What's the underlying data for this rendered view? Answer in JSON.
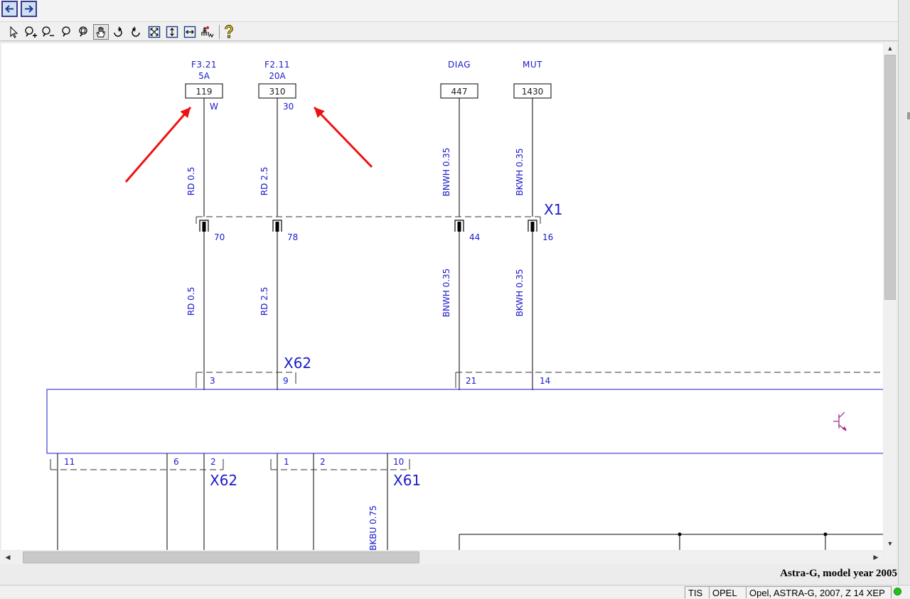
{
  "toolbar": {
    "tools": [
      "select-tool",
      "zoom-in-tool",
      "zoom-out-tool",
      "zoom-tool",
      "zoom-window-tool",
      "pan-tool",
      "rotate-left-tool",
      "rotate-right-tool",
      "fit-page-tool",
      "fit-height-tool",
      "fit-width-tool",
      "fuse-info-tool",
      "help-tool"
    ]
  },
  "diagram": {
    "colors": {
      "text": "#1a1acc",
      "wire": "#000000",
      "arrow": "#ee1111",
      "component": "#1a1acc",
      "symbol": "#a0208c"
    },
    "fuses": [
      {
        "name": "F3.21",
        "rating": "5A",
        "number": "119",
        "pin": "W"
      },
      {
        "name": "F2.11",
        "rating": "20A",
        "number": "310",
        "pin": "30"
      },
      {
        "name": "DIAG",
        "rating": "",
        "number": "447",
        "pin": ""
      },
      {
        "name": "MUT",
        "rating": "",
        "number": "1430",
        "pin": ""
      }
    ],
    "wires_upper": [
      "RD 0.5",
      "RD 2.5",
      "BNWH 0.35",
      "BKWH 0.35"
    ],
    "wires_lower": [
      "RD 0.5",
      "RD 2.5",
      "BNWH 0.35",
      "BKWH 0.35"
    ],
    "connector_x1": {
      "label": "X1",
      "pins": [
        "70",
        "78",
        "44",
        "16"
      ]
    },
    "connector_x62_top": {
      "label": "X62",
      "pins": [
        "3",
        "9",
        "21",
        "14"
      ]
    },
    "connector_x62_bottom": {
      "label": "X62",
      "pins": [
        "11",
        "6",
        "2"
      ]
    },
    "connector_x61": {
      "label": "X61",
      "pins": [
        "1",
        "2",
        "10"
      ]
    },
    "wire_bottom": "BKBU 0.75"
  },
  "caption": "Astra-G, model year 2005",
  "statusbar": {
    "cell1": "TIS",
    "cell2": "OPEL",
    "cell3": "Opel, ASTRA-G, 2007, Z 14 XEP"
  }
}
